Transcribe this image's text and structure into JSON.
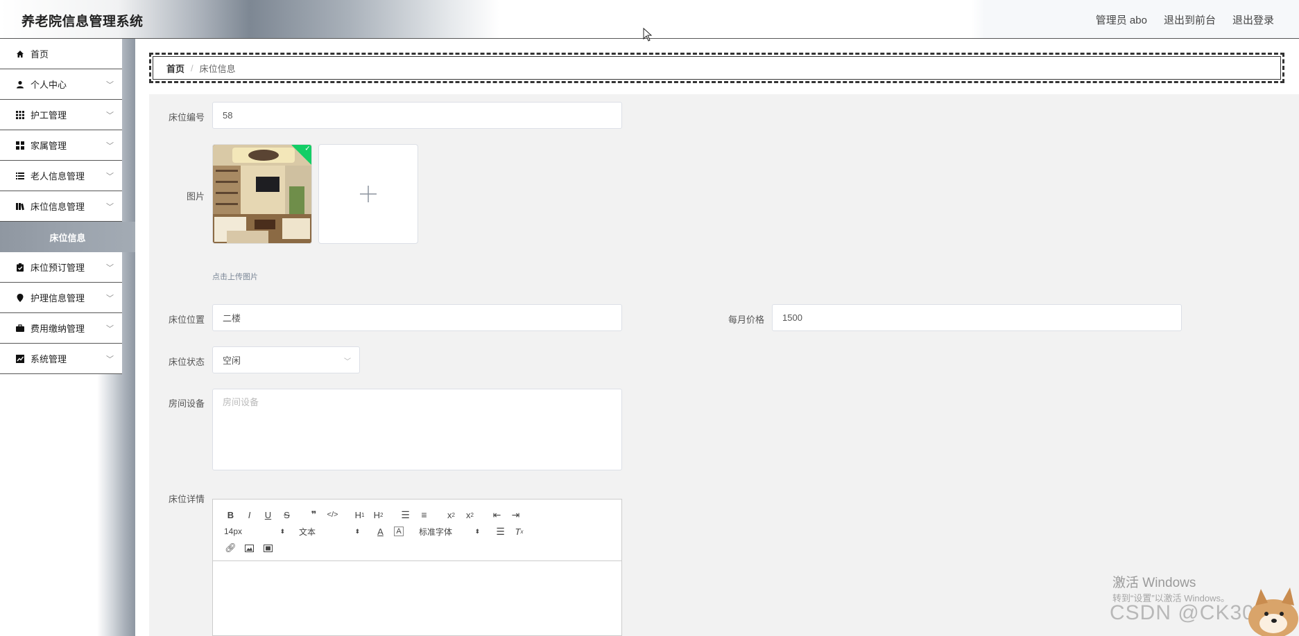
{
  "header": {
    "app_title": "养老院信息管理系统",
    "user_label": "管理员 abo",
    "frontend_link": "退出到前台",
    "logout_link": "退出登录"
  },
  "sidebar": {
    "items": [
      {
        "label": "首页",
        "icon": "home-icon",
        "has_chevron": false
      },
      {
        "label": "个人中心",
        "icon": "user-icon",
        "has_chevron": true
      },
      {
        "label": "护工管理",
        "icon": "grid-icon",
        "has_chevron": true
      },
      {
        "label": "家属管理",
        "icon": "apps-icon",
        "has_chevron": true
      },
      {
        "label": "老人信息管理",
        "icon": "list-icon",
        "has_chevron": true
      },
      {
        "label": "床位信息管理",
        "icon": "book-icon",
        "has_chevron": true
      },
      {
        "label": "床位预订管理",
        "icon": "clipboard-check-icon",
        "has_chevron": true
      },
      {
        "label": "护理信息管理",
        "icon": "location-pin-icon",
        "has_chevron": true
      },
      {
        "label": "费用缴纳管理",
        "icon": "briefcase-icon",
        "has_chevron": true
      },
      {
        "label": "系统管理",
        "icon": "chart-icon",
        "has_chevron": true
      }
    ],
    "active_subitem": "床位信息"
  },
  "breadcrumb": {
    "home": "首页",
    "separator": "/",
    "current": "床位信息"
  },
  "form": {
    "bed_number_label": "床位编号",
    "bed_number_value": "58",
    "image_label": "图片",
    "upload_tip": "点击上传图片",
    "location_label": "床位位置",
    "location_value": "二楼",
    "price_label": "每月价格",
    "price_value": "1500",
    "status_label": "床位状态",
    "status_value": "空闲",
    "equipment_label": "房间设备",
    "equipment_placeholder": "房间设备",
    "detail_label": "床位详情"
  },
  "editor": {
    "font_size": "14px",
    "format": "文本",
    "font_family": "标准字体"
  },
  "watermarks": {
    "activate_title": "激活 Windows",
    "activate_sub": "转到“设置”以激活 Windows。",
    "csdn": "CSDN @CK3040"
  },
  "colors": {
    "header_gradient_dark": "#7d8793",
    "sidebar_active_bg": "#9ba3ad",
    "form_bg": "#f2f2f2",
    "upload_success": "#13ce66"
  }
}
